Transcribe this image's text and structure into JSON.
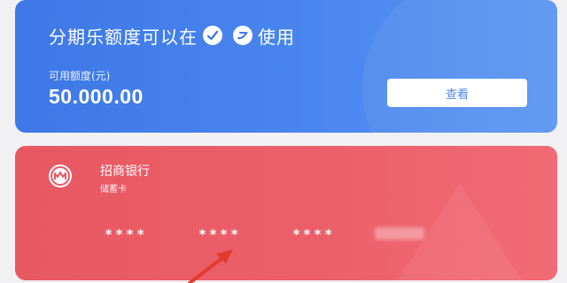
{
  "credit_banner": {
    "headline_part1": "分期乐额度可以在",
    "headline_part2": "使用",
    "available_label": "可用额度(元)",
    "available_amount": "50.000.00",
    "view_button": "查看"
  },
  "bank_card": {
    "bank_name": "招商银行",
    "card_type": "储蓄卡",
    "number_groups": [
      "****",
      "****",
      "****"
    ]
  },
  "colors": {
    "credit_blue": "#4a86ef",
    "debit_red": "#ec5f6a",
    "arrow_red": "#e23b2e"
  }
}
